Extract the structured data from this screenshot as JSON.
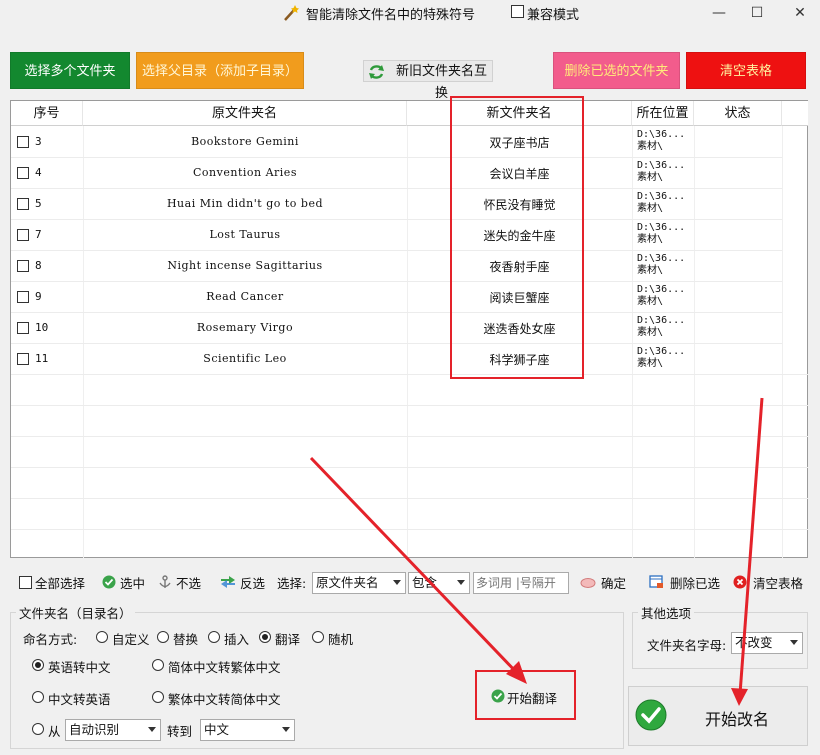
{
  "window": {
    "title": "智能清除文件名中的特殊符号",
    "compat_label": "兼容模式",
    "min": "—",
    "max": "☐",
    "close": "✕"
  },
  "toolbar_top": {
    "select_multi": "选择多个文件夹",
    "select_parent": "选择父目录（添加子目录）",
    "swap": "新旧文件夹名互换",
    "delete_selected": "删除已选的文件夹",
    "clear_table": "清空表格"
  },
  "table": {
    "headers": [
      "序号",
      "原文件夹名",
      "新文件夹名",
      "所在位置",
      "状态"
    ],
    "rows": [
      {
        "num": "3",
        "orig": "Bookstore Gemini",
        "new": "双子座书店",
        "loc1": "D:\\36...",
        "loc2": "素材\\",
        "state": ""
      },
      {
        "num": "4",
        "orig": "Convention Aries",
        "new": "会议白羊座",
        "loc1": "D:\\36...",
        "loc2": "素材\\",
        "state": ""
      },
      {
        "num": "5",
        "orig": "Huai Min didn't go to bed",
        "new": "怀民没有睡觉",
        "loc1": "D:\\36...",
        "loc2": "素材\\",
        "state": ""
      },
      {
        "num": "7",
        "orig": "Lost Taurus",
        "new": "迷失的金牛座",
        "loc1": "D:\\36...",
        "loc2": "素材\\",
        "state": ""
      },
      {
        "num": "8",
        "orig": "Night incense Sagittarius",
        "new": "夜香射手座",
        "loc1": "D:\\36...",
        "loc2": "素材\\",
        "state": ""
      },
      {
        "num": "9",
        "orig": "Read Cancer",
        "new": "阅读巨蟹座",
        "loc1": "D:\\36...",
        "loc2": "素材\\",
        "state": ""
      },
      {
        "num": "10",
        "orig": "Rosemary Virgo",
        "new": "迷迭香处女座",
        "loc1": "D:\\36...",
        "loc2": "素材\\",
        "state": ""
      },
      {
        "num": "11",
        "orig": "Scientific Leo",
        "new": "科学狮子座",
        "loc1": "D:\\36...",
        "loc2": "素材\\",
        "state": ""
      }
    ]
  },
  "toolbar_bottom": {
    "select_all": "全部选择",
    "select": "选中",
    "deselect": "不选",
    "invert": "反选",
    "choose_label": "选择:",
    "field_value": "原文件夹名",
    "match_value": "包含",
    "keyword_placeholder": "多词用 |号隔开",
    "confirm": "确定",
    "delete_selected": "删除已选",
    "clear_table": "清空表格"
  },
  "naming": {
    "group_title": "文件夹名（目录名）",
    "mode_label": "命名方式:",
    "modes": [
      "自定义",
      "替换",
      "插入",
      "翻译",
      "随机"
    ],
    "selected_mode": "翻译",
    "options": {
      "en_to_zh": "英语转中文",
      "zh_to_en": "中文转英语",
      "simp_to_trad": "简体中文转繁体中文",
      "trad_to_simp": "繁体中文转简体中文",
      "from_label": "从",
      "from_value": "自动识别",
      "to_label": "转到",
      "to_value": "中文"
    },
    "start_translate": "开始翻译"
  },
  "other": {
    "group_title": "其他选项",
    "case_label": "文件夹名字母:",
    "case_value": "不改变"
  },
  "rename_button": "开始改名",
  "colors": {
    "green": "#13882f",
    "orange": "#f19c1d",
    "pink": "#f25c8c",
    "red": "#ee1111",
    "highlight": "#e4222a"
  }
}
